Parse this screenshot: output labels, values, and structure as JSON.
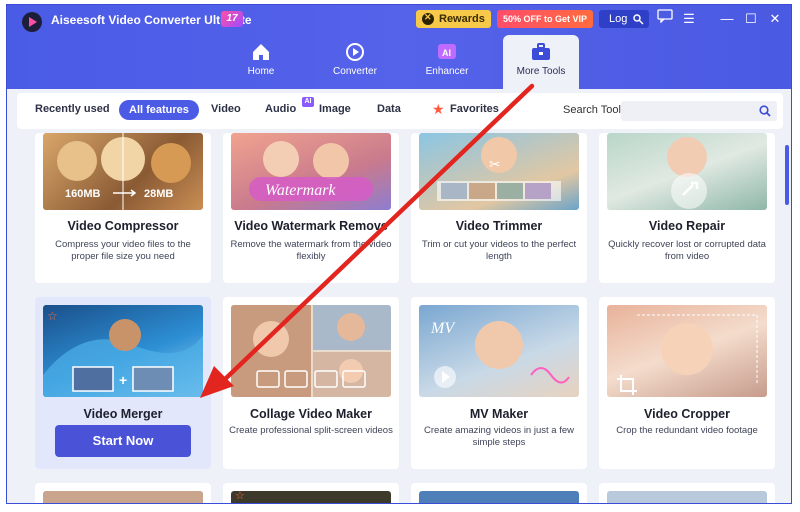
{
  "app": {
    "title": "Aiseesoft Video Converter Ultimate",
    "badge": "17",
    "rewards_label": "Rewards",
    "vip_label": "50% OFF to Get VIP",
    "login_label": "Log in"
  },
  "nav": [
    {
      "label": "Home",
      "icon": "home-icon"
    },
    {
      "label": "Converter",
      "icon": "converter-icon"
    },
    {
      "label": "Enhancer",
      "icon": "enhancer-icon"
    },
    {
      "label": "More Tools",
      "icon": "toolbox-icon",
      "active": true
    }
  ],
  "filters": {
    "recently_used": "Recently used",
    "all_features": "All features",
    "video": "Video",
    "audio": "Audio",
    "audio_badge": "AI",
    "image": "Image",
    "data": "Data",
    "favorites": "Favorites",
    "search_label": "Search Tool:",
    "search_value": ""
  },
  "thumb_text": {
    "size_from": "160MB",
    "size_to": "28MB",
    "watermark": "Watermark",
    "mv_text": "MV"
  },
  "tools": [
    {
      "title": "Video Compressor",
      "desc": "Compress your video files to the proper file size you need"
    },
    {
      "title": "Video Watermark Remove",
      "desc": "Remove the watermark from the video flexibly"
    },
    {
      "title": "Video Trimmer",
      "desc": "Trim or cut your videos to the perfect length"
    },
    {
      "title": "Video Repair",
      "desc": "Quickly recover lost or corrupted data from video"
    },
    {
      "title": "Video Merger",
      "desc": "",
      "button": "Start Now"
    },
    {
      "title": "Collage Video Maker",
      "desc": "Create professional split-screen videos"
    },
    {
      "title": "MV Maker",
      "desc": "Create amazing videos in just a few simple steps"
    },
    {
      "title": "Video Cropper",
      "desc": "Crop the redundant video footage"
    }
  ],
  "colors": {
    "accent": "#4b5be6",
    "arrow": "#e3251f"
  }
}
